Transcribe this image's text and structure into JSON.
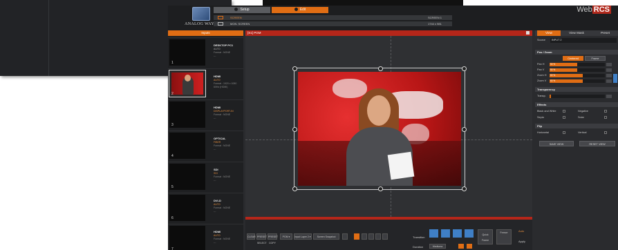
{
  "brand": {
    "logo_text": "ANALOG WAY®",
    "app_name_a": "Web",
    "app_name_b": "RCS"
  },
  "tabs": [
    {
      "label": "Setup"
    },
    {
      "label": "Edit"
    }
  ],
  "info": {
    "row1_left": "SCREEN",
    "row1_right": "SCREEN 1",
    "row2_left": "MON. SCREEN",
    "row2_right": "1744 x 981"
  },
  "sources": {
    "header": "Inputs",
    "items": [
      {
        "num": "1",
        "name": "DESKTOP PC1",
        "l2": "AUTO",
        "l3": "Format : NONE",
        "l4": "---"
      },
      {
        "num": "2",
        "name": "HDMI",
        "l2": "AUTO",
        "l3": "Format : 1920 x 1080",
        "l4": "60Hz (HDMI)"
      },
      {
        "num": "3",
        "name": "HDMI",
        "l2": "DISPLAYPORT-IN",
        "l3": "Format : NONE",
        "l4": "---"
      },
      {
        "num": "4",
        "name": "OPTICAL",
        "l2": "FIBER",
        "l3": "Format : NONE",
        "l4": "---"
      },
      {
        "num": "5",
        "name": "SDI",
        "l2": "SDI",
        "l3": "Format : NONE",
        "l4": "---"
      },
      {
        "num": "6",
        "name": "DVI-D",
        "l2": "AUTO",
        "l3": "Format : NONE",
        "l4": "---"
      },
      {
        "num": "7",
        "name": "HDMI",
        "l2": "AUTO",
        "l3": "Format : NONE",
        "l4": "---"
      }
    ]
  },
  "center": {
    "title": "[S1] PGM"
  },
  "toolbar": {
    "b1": "CLEAR",
    "b2": "PRESET SELECT",
    "b3": "PRESET COPY",
    "b4": "PGM ▾",
    "b5": "Input Layer 2 ▾",
    "b6": "Screen Snapshot",
    "transition_label": "Transition",
    "duration_label": "Duration",
    "duration_value": "Mediuma",
    "quick_frame": "Quick Frame",
    "freeze": "Freeze",
    "auto": "Auto",
    "apply": "Apply"
  },
  "right": {
    "tab1": "View",
    "tab2": "View Mask",
    "tab3": "Preset",
    "source_label": "Source",
    "source_value": "INPUT 2",
    "pos_section": "Pos / Zoom",
    "btn_centered": "Centered",
    "btn_frame": "Frame",
    "rows": [
      {
        "label": "Pan H",
        "value": "50 %",
        "fill": 0.5
      },
      {
        "label": "Pan V",
        "value": "50 %",
        "fill": 0.5
      },
      {
        "label": "Zoom H",
        "value": "60 %",
        "fill": 0.6
      },
      {
        "label": "Zoom V",
        "value": "60 %",
        "fill": 0.6
      }
    ],
    "transp_section": "Transparency",
    "transp_label": "Transp.",
    "effects_section": "Effects",
    "eff1": "Black and White",
    "eff2": "Negative",
    "eff3": "Sepia",
    "eff4": "Solar",
    "flip_section": "Flip",
    "flip1": "Horizontal",
    "flip2": "Vertical",
    "save_btn": "SAVE VIEW",
    "reset_btn": "RESET VIEW"
  }
}
